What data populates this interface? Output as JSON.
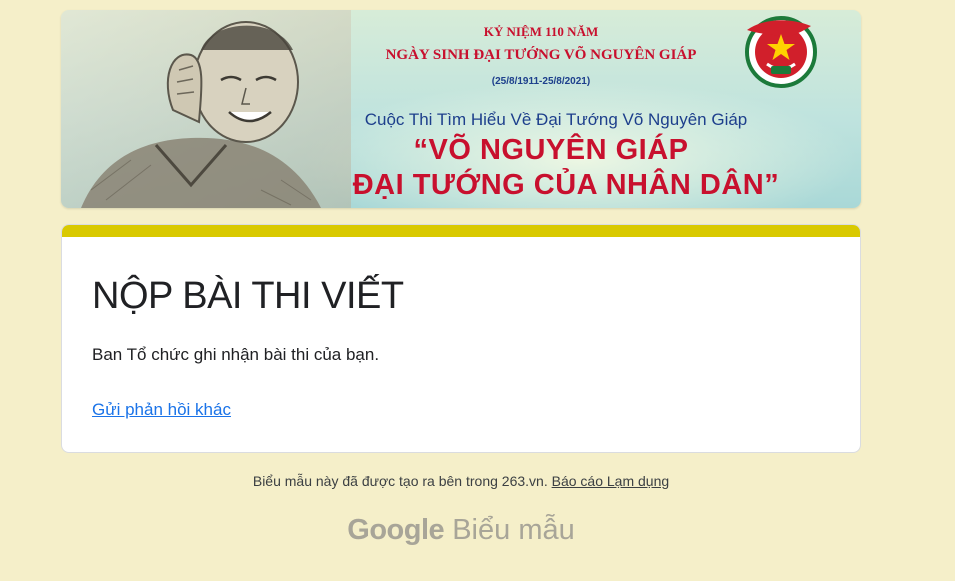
{
  "banner": {
    "line1": "KỶ NIỆM 110 NĂM",
    "line2": "NGÀY SINH ĐẠI TƯỚNG VÕ NGUYÊN GIÁP",
    "dates": "(25/8/1911-25/8/2021)",
    "contest": "Cuộc Thi Tìm Hiểu Về Đại Tướng Võ Nguyên Giáp",
    "headline1": "“VÕ NGUYÊN GIÁP",
    "headline2": "ĐẠI TƯỚNG CỦA NHÂN DÂN”"
  },
  "form": {
    "title": "NỘP BÀI THI VIẾT",
    "confirmation": "Ban Tổ chức ghi nhận bài thi của bạn.",
    "resubmit_link": "Gửi phản hồi khác"
  },
  "footer": {
    "note": "Biểu mẫu này đã được tạo ra bên trong 263.vn.",
    "report_link": "Báo cáo Lạm dụng",
    "brand_google": "Google",
    "brand_forms": "Biểu mẫu"
  },
  "colors": {
    "page_background": "#f5efc9",
    "card_accent": "#d9c900",
    "link": "#1a73e8",
    "banner_red": "#c8102e",
    "banner_blue": "#1d3f8c"
  }
}
